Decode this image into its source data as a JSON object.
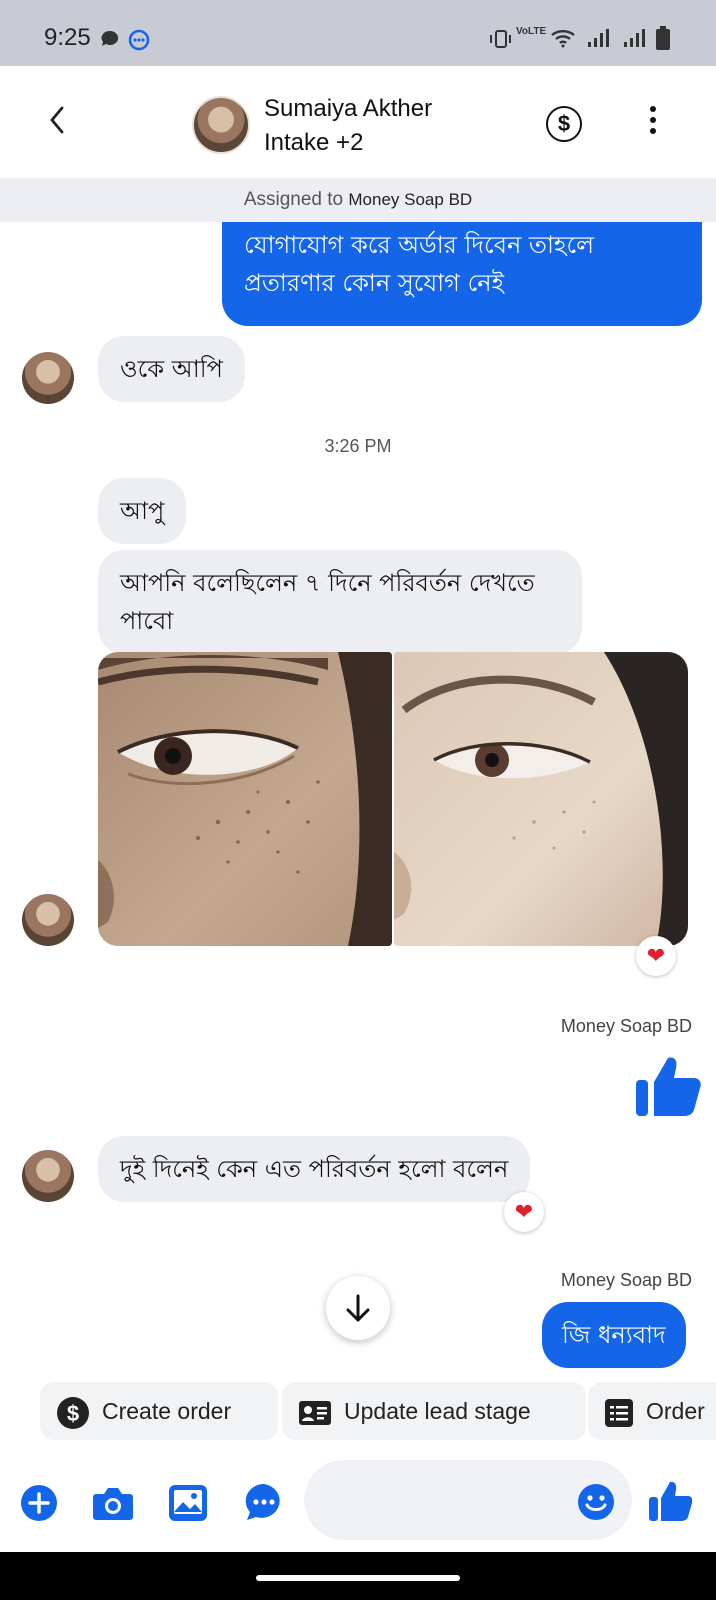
{
  "status_bar": {
    "time": "9:25",
    "icons": [
      "chat-bubble-icon",
      "messenger-icon",
      "vibrate-icon",
      "volte-icon",
      "wifi-icon",
      "signal-icon",
      "signal-icon",
      "battery-icon"
    ],
    "volte_text": "VoLTE"
  },
  "header": {
    "contact_name": "Sumaiya Akther",
    "subtitle": "Intake +2",
    "payment_icon": "dollar-circle-icon",
    "more_icon": "kebab-menu-icon"
  },
  "assigned": {
    "prefix": "Assigned to",
    "page": "Money Soap BD"
  },
  "messages": {
    "m1_line1": "যোগাযোগ করে অর্ডার দিবেন তাহলে",
    "m1_line2": "প্রতারণার কোন সুযোগ নেই",
    "m2": "ওকে আপি",
    "time_divider": "3:26 PM",
    "m3": "আপু",
    "m4_line1": "আপনি বলেছিলেন ৭ দিনে পরিবর্তন দেখতে",
    "m4_line2": "পাবো",
    "sender_1": "Money Soap BD",
    "m6": "দুই দিনেই কেন এত পরিবর্তন হলো বলেন",
    "sender_2": "Money Soap BD",
    "m7": "জি ধন্যবাদ"
  },
  "quick_actions": [
    {
      "label": "Create order",
      "icon": "dollar-circle-icon"
    },
    {
      "label": "Update lead stage",
      "icon": "contact-card-icon"
    },
    {
      "label": "Order",
      "icon": "list-icon"
    }
  ],
  "composer": {
    "icons": [
      "plus-icon",
      "camera-icon",
      "gallery-icon",
      "more-apps-icon",
      "emoji-icon",
      "thumbs-up-icon"
    ]
  },
  "colors": {
    "brand_blue": "#1565e8",
    "incoming_bubble": "#eceef1",
    "reaction_red": "#e0202c",
    "status_bar": "#c8cbd4"
  }
}
